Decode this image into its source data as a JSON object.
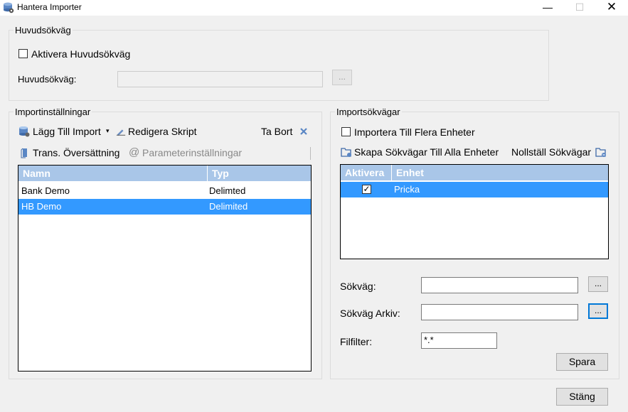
{
  "window": {
    "title": "Hantera Importer",
    "min_glyph": "—",
    "max_glyph": "☐",
    "close_glyph": "✕"
  },
  "main_path_group": {
    "legend": "Huvudsökväg",
    "enable_label": "Aktivera Huvudsökväg",
    "enable_checked": false,
    "path_label": "Huvudsökväg:",
    "path_value": "",
    "browse_label": "..."
  },
  "import_settings": {
    "legend": "Importinställningar",
    "toolbar": {
      "add_import": "Lägg Till Import",
      "edit_script": "Redigera Skript",
      "delete": "Ta Bort",
      "translation": "Trans. Översättning",
      "parameters": "Parameterinställningar"
    },
    "grid": {
      "columns": [
        "Namn",
        "Typ"
      ],
      "rows": [
        {
          "name": "Bank Demo",
          "type": "Delimted",
          "selected": false
        },
        {
          "name": "HB Demo",
          "type": "Delimited",
          "selected": true
        }
      ]
    }
  },
  "import_paths": {
    "legend": "Importsökvägar",
    "multi_label": "Importera Till Flera Enheter",
    "multi_checked": false,
    "create_paths": "Skapa Sökvägar Till Alla Enheter",
    "reset_paths": "Nollställ Sökvägar",
    "grid": {
      "columns": [
        "Aktivera",
        "Enhet"
      ],
      "rows": [
        {
          "active": true,
          "unit": "Pricka",
          "selected": true
        }
      ]
    },
    "path_label": "Sökväg:",
    "path_value": "",
    "archive_label": "Sökväg Arkiv:",
    "archive_value": "",
    "filter_label": "Filfilter:",
    "filter_value": "*.*",
    "browse_label": "...",
    "save_label": "Spara"
  },
  "close_label": "Stäng",
  "check_glyph": "✓",
  "colors": {
    "selection": "#3399ff",
    "grid_header": "#a9c6e8",
    "focus_border": "#0078d7"
  }
}
